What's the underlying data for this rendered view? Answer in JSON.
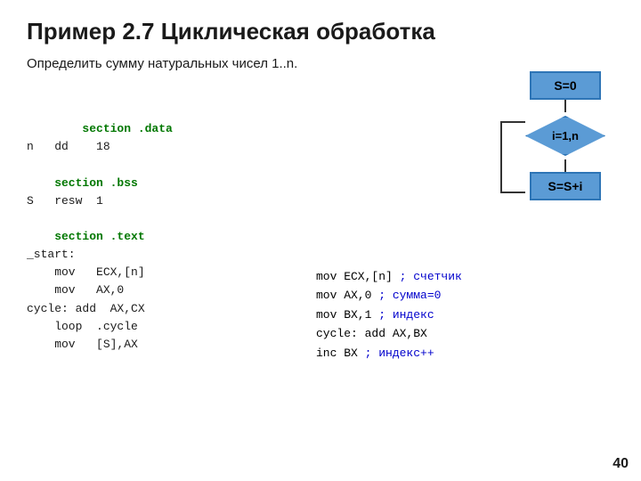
{
  "title": "Пример 2.7 Циклическая обработка",
  "subtitle": "Определить сумму натуральных чисел 1..n.",
  "left_code": {
    "line1": "    section .data",
    "line2": "n   dd    18",
    "line3": "",
    "line4": "    section .bss",
    "line5": "S   resw  1",
    "line6": "",
    "line7": "    section .text",
    "line8": "_start:",
    "line9": "    mov   ECX,[n]",
    "line10": "    mov   AX,0",
    "line11": "cycle: add  AX,CX",
    "line12": "    loop  .cycle",
    "line13": "    mov   [S],AX"
  },
  "right_code": {
    "line1": "        mov   ECX,[n]",
    "comment1": " ; счетчик",
    "line2": "        mov   AX,0",
    "comment2": "   ; сумма=0",
    "line3": "        mov   BX,1",
    "comment3": "   ; индекс",
    "line4": "cycle: add  AX,BX",
    "line5": "        inc   BX",
    "comment5": "         ; индекс++"
  },
  "flowchart": {
    "box1": "S=0",
    "diamond": "i=1,n",
    "box2": "S=S+i"
  },
  "page_number": "40"
}
